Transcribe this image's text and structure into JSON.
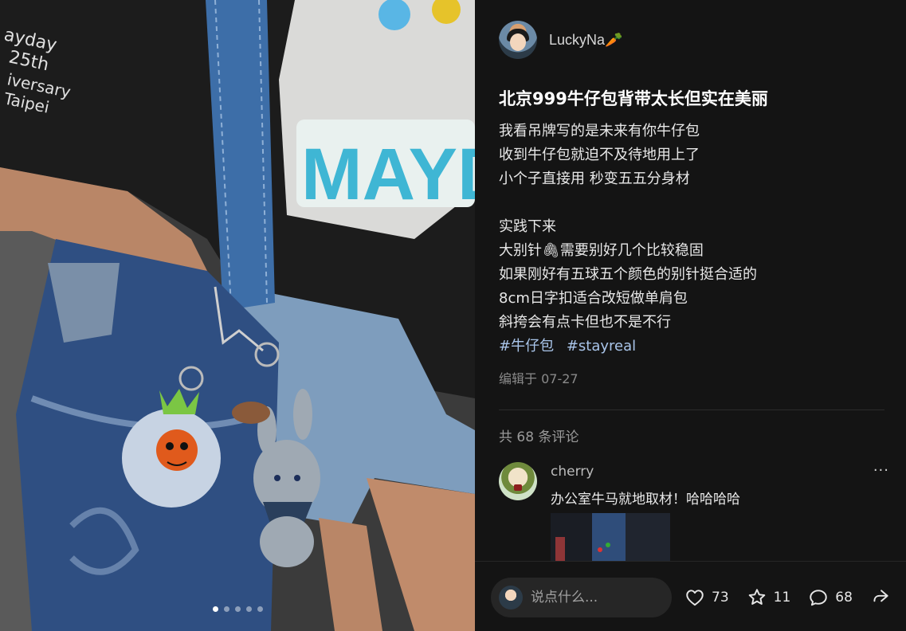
{
  "photo": {
    "shirt_print": "MAYDA",
    "sleeve_print": [
      "ayday",
      "25th",
      "iversary",
      "Taipei"
    ],
    "carousel_total": 5,
    "carousel_active": 1
  },
  "author": {
    "name": "LuckyNa",
    "name_emoji": "🥕"
  },
  "post": {
    "title": "北京999牛仔包背带太长但实在美丽",
    "lines": [
      "我看吊牌写的是未来有你牛仔包",
      "收到牛仔包就迫不及待地用上了",
      "小个子直接用 秒变五五分身材",
      "",
      "实践下来",
      "大别针🖇需要别好几个比较稳固",
      "如果刚好有五球五个颜色的别针挺合适的",
      "8cm日字扣适合改短做单肩包",
      "斜挎会有点卡但也不是不行"
    ],
    "tags": [
      "#牛仔包",
      "#stayreal"
    ],
    "edited": "编辑于 07-27"
  },
  "comments": {
    "count_label": "共 68 条评论",
    "items": [
      {
        "user": "cherry",
        "text": "办公室牛马就地取材！哈哈哈哈",
        "more": "···"
      }
    ]
  },
  "bottom": {
    "input_placeholder": "说点什么...",
    "likes": "73",
    "favorites": "11",
    "comments": "68"
  },
  "colors": {
    "background": "#141414",
    "tag": "#a9c5ea",
    "muted": "#8a8a8a"
  }
}
